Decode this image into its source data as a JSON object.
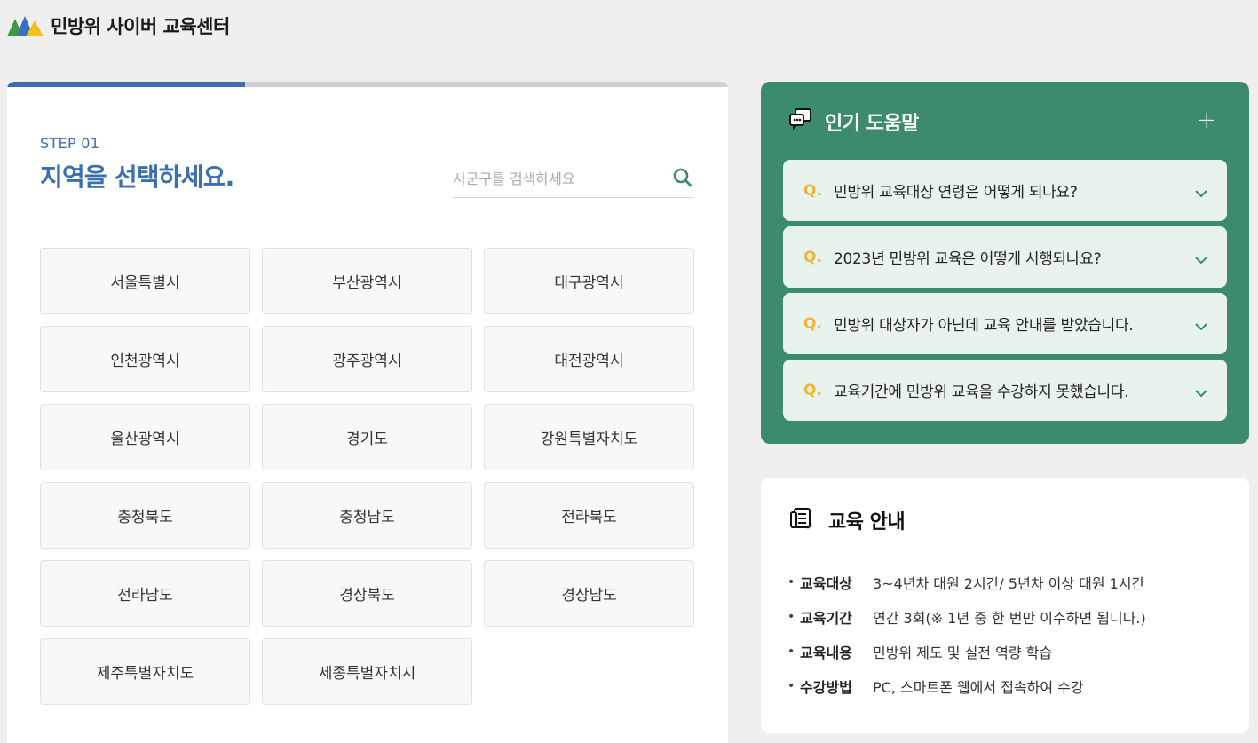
{
  "header": {
    "site_title": "민방위 사이버 교육센터"
  },
  "step": {
    "progress_fraction": 0.33,
    "label": "STEP 01",
    "title": "지역을 선택하세요."
  },
  "search": {
    "placeholder": "시군구를 검색하세요",
    "value": ""
  },
  "regions": [
    "서울특별시",
    "부산광역시",
    "대구광역시",
    "인천광역시",
    "광주광역시",
    "대전광역시",
    "울산광역시",
    "경기도",
    "강원특별자치도",
    "충청북도",
    "충청남도",
    "전라북도",
    "전라남도",
    "경상북도",
    "경상남도",
    "제주특별자치도",
    "세종특별자치시"
  ],
  "help": {
    "title": "인기 도움말",
    "plus": "+",
    "q_marker": "Q.",
    "faqs": [
      "민방위 교육대상 연령은 어떻게 되나요?",
      "2023년 민방위 교육은 어떻게 시행되나요?",
      "민방위 대상자가 아닌데 교육 안내를 받았습니다.",
      "교육기간에 민방위 교육을 수강하지 못했습니다."
    ]
  },
  "edu": {
    "title": "교육 안내",
    "bullet": "•",
    "items": [
      {
        "label": "교육대상",
        "value": "3~4년차 대원 2시간/ 5년차 이상 대원 1시간"
      },
      {
        "label": "교육기간",
        "value": "연간 3회(※ 1년 중 한 번만 이수하면 됩니다.)"
      },
      {
        "label": "교육내용",
        "value": "민방위 제도 및 실전 역량 학습"
      },
      {
        "label": "수강방법",
        "value": "PC, 스마트폰 웹에서 접속하여 수강"
      }
    ]
  },
  "colors": {
    "primary_blue": "#3b6fb0",
    "help_green": "#3c8b6b",
    "faq_bg": "#e8f3ee",
    "q_yellow": "#f2b636"
  }
}
